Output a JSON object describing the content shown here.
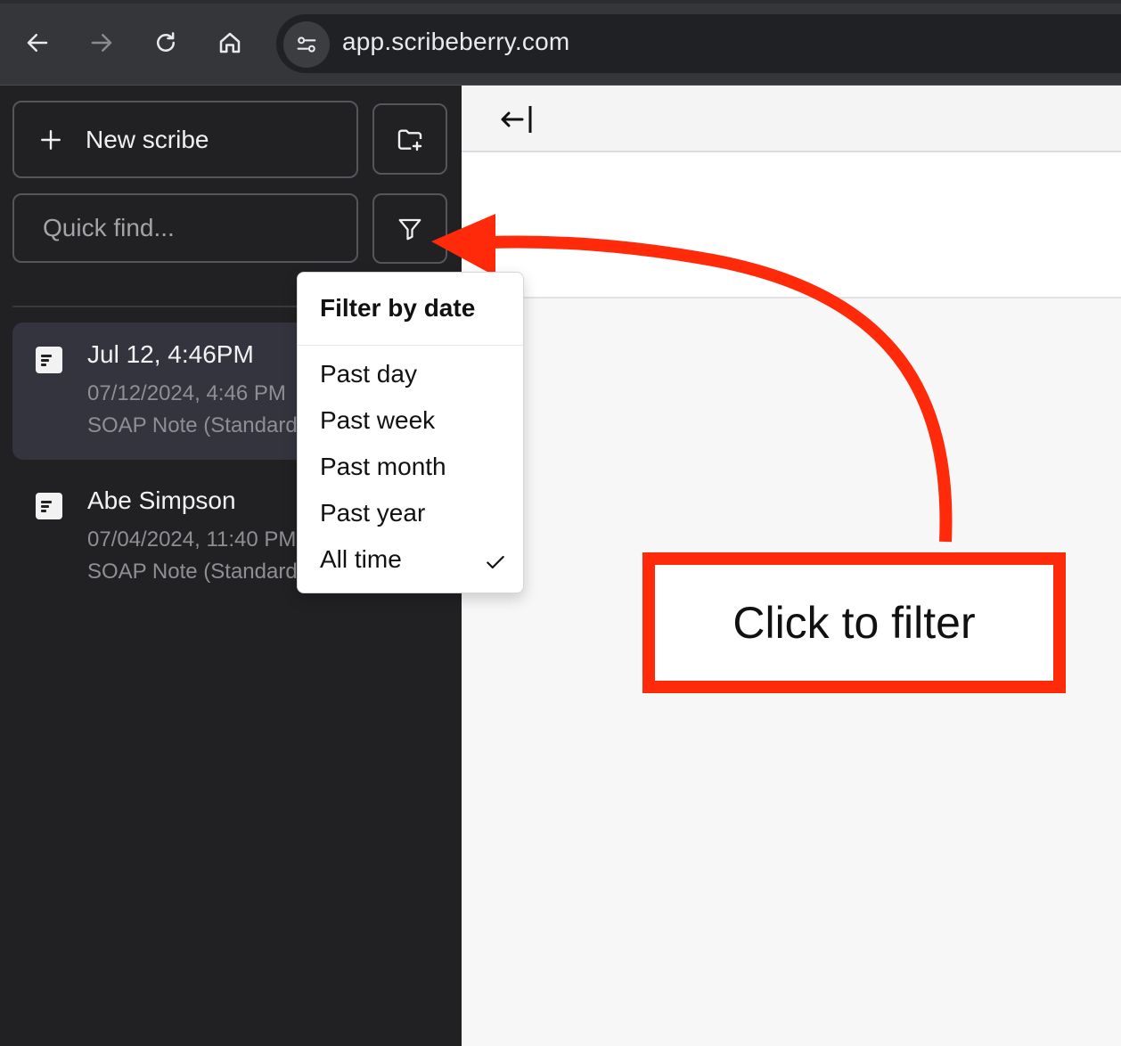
{
  "browser": {
    "url": "app.scribeberry.com"
  },
  "sidebar": {
    "new_scribe_label": "New scribe",
    "search_placeholder": "Quick find...",
    "scribes": [
      {
        "title": "Jul 12, 4:46PM",
        "date": "07/12/2024, 4:46 PM",
        "template": "SOAP Note (Standard",
        "selected": true
      },
      {
        "title": "Abe Simpson",
        "date": "07/04/2024, 11:40 PM",
        "template": "SOAP Note (Standard",
        "selected": false
      }
    ]
  },
  "filter_menu": {
    "header": "Filter by date",
    "options": [
      "Past day",
      "Past week",
      "Past month",
      "Past year",
      "All time"
    ],
    "selected": "All time"
  },
  "annotation": {
    "callout_text": "Click to filter",
    "color": "#ff2a0a"
  },
  "icons": [
    "back-arrow-icon",
    "forward-arrow-icon",
    "reload-icon",
    "home-icon",
    "site-settings-icon",
    "plus-icon",
    "new-folder-icon",
    "filter-icon",
    "document-icon",
    "collapse-sidebar-icon",
    "checkmark-icon"
  ]
}
